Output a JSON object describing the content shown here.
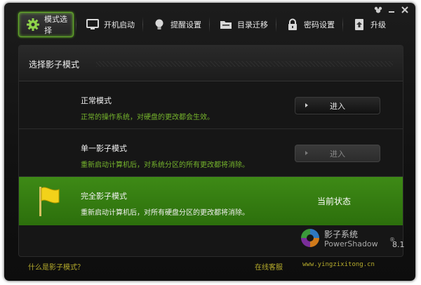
{
  "tabs": [
    {
      "label": "模式选择",
      "icon": "gear-icon",
      "active": true
    },
    {
      "label": "开机启动",
      "icon": "monitor-icon",
      "active": false
    },
    {
      "label": "提醒设置",
      "icon": "bulb-icon",
      "active": false
    },
    {
      "label": "目录迁移",
      "icon": "folder-icon",
      "active": false
    },
    {
      "label": "密码设置",
      "icon": "lock-icon",
      "active": false
    },
    {
      "label": "升级",
      "icon": "upgrade-icon",
      "active": false
    }
  ],
  "panel": {
    "title": "选择影子模式",
    "modes": [
      {
        "name": "正常模式",
        "description": "正常的操作系统，对硬盘的更改都会生效。",
        "button": "进入",
        "state": "enabled"
      },
      {
        "name": "单一影子模式",
        "description": "重新启动计算机后，对系统分区的所有更改都将消除。",
        "button": "进入",
        "state": "disabled"
      },
      {
        "name": "完全影子模式",
        "description": "重新启动计算机后，对所有硬盘分区的更改都将消除。",
        "status": "当前状态",
        "state": "current",
        "icon": "flag-icon"
      }
    ]
  },
  "brand": {
    "name_cn": "影子系统",
    "name_en": "PowerShadow",
    "reg": "®",
    "version": "8.1"
  },
  "footer": {
    "help": "什么是影子模式？",
    "support": "在线客服",
    "website": "www.yingzixitong.cn"
  },
  "colors": {
    "accent": "#62a82a",
    "current_row": "#3a8314",
    "footer_link": "#b6ac2c"
  }
}
